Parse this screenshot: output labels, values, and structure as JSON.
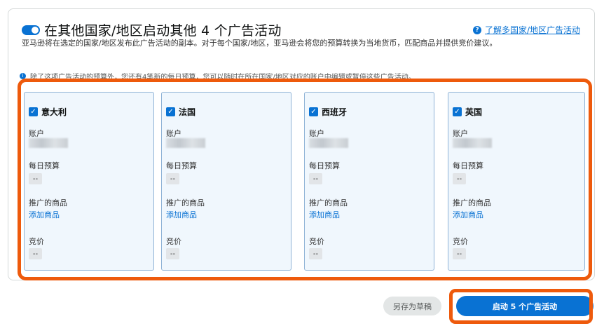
{
  "header": {
    "title": "在其他国家/地区启动其他 4 个广告活动",
    "help_link": "了解多国家/地区广告活动",
    "help_icon": "?",
    "description": "亚马逊将在选定的国家/地区发布此广告活动的副本。对于每个国家/地区，亚马逊会将您的预算转换为当地货币，匹配商品并提供竞价建议。"
  },
  "info": {
    "text": "除了这项广告活动的预算外，您还有4笔新的每日预算，您可以随时在所在国家/地区对应的账户中编辑或暂停这些广告活动。"
  },
  "labels": {
    "account": "账户",
    "daily_budget": "每日预算",
    "promoted_products": "推广的商品",
    "add_products": "添加商品",
    "bid": "竞价",
    "empty_value": "--"
  },
  "countries": [
    {
      "name": "意大利",
      "checked": true
    },
    {
      "name": "法国",
      "checked": true
    },
    {
      "name": "西班牙",
      "checked": true
    },
    {
      "name": "英国",
      "checked": true
    }
  ],
  "actions": {
    "save_draft": "另存为草稿",
    "launch": "启动 5 个广告活动"
  },
  "colors": {
    "accent": "#0972d3",
    "highlight": "#ee5a0c",
    "card_bg": "#f0f7fd"
  }
}
